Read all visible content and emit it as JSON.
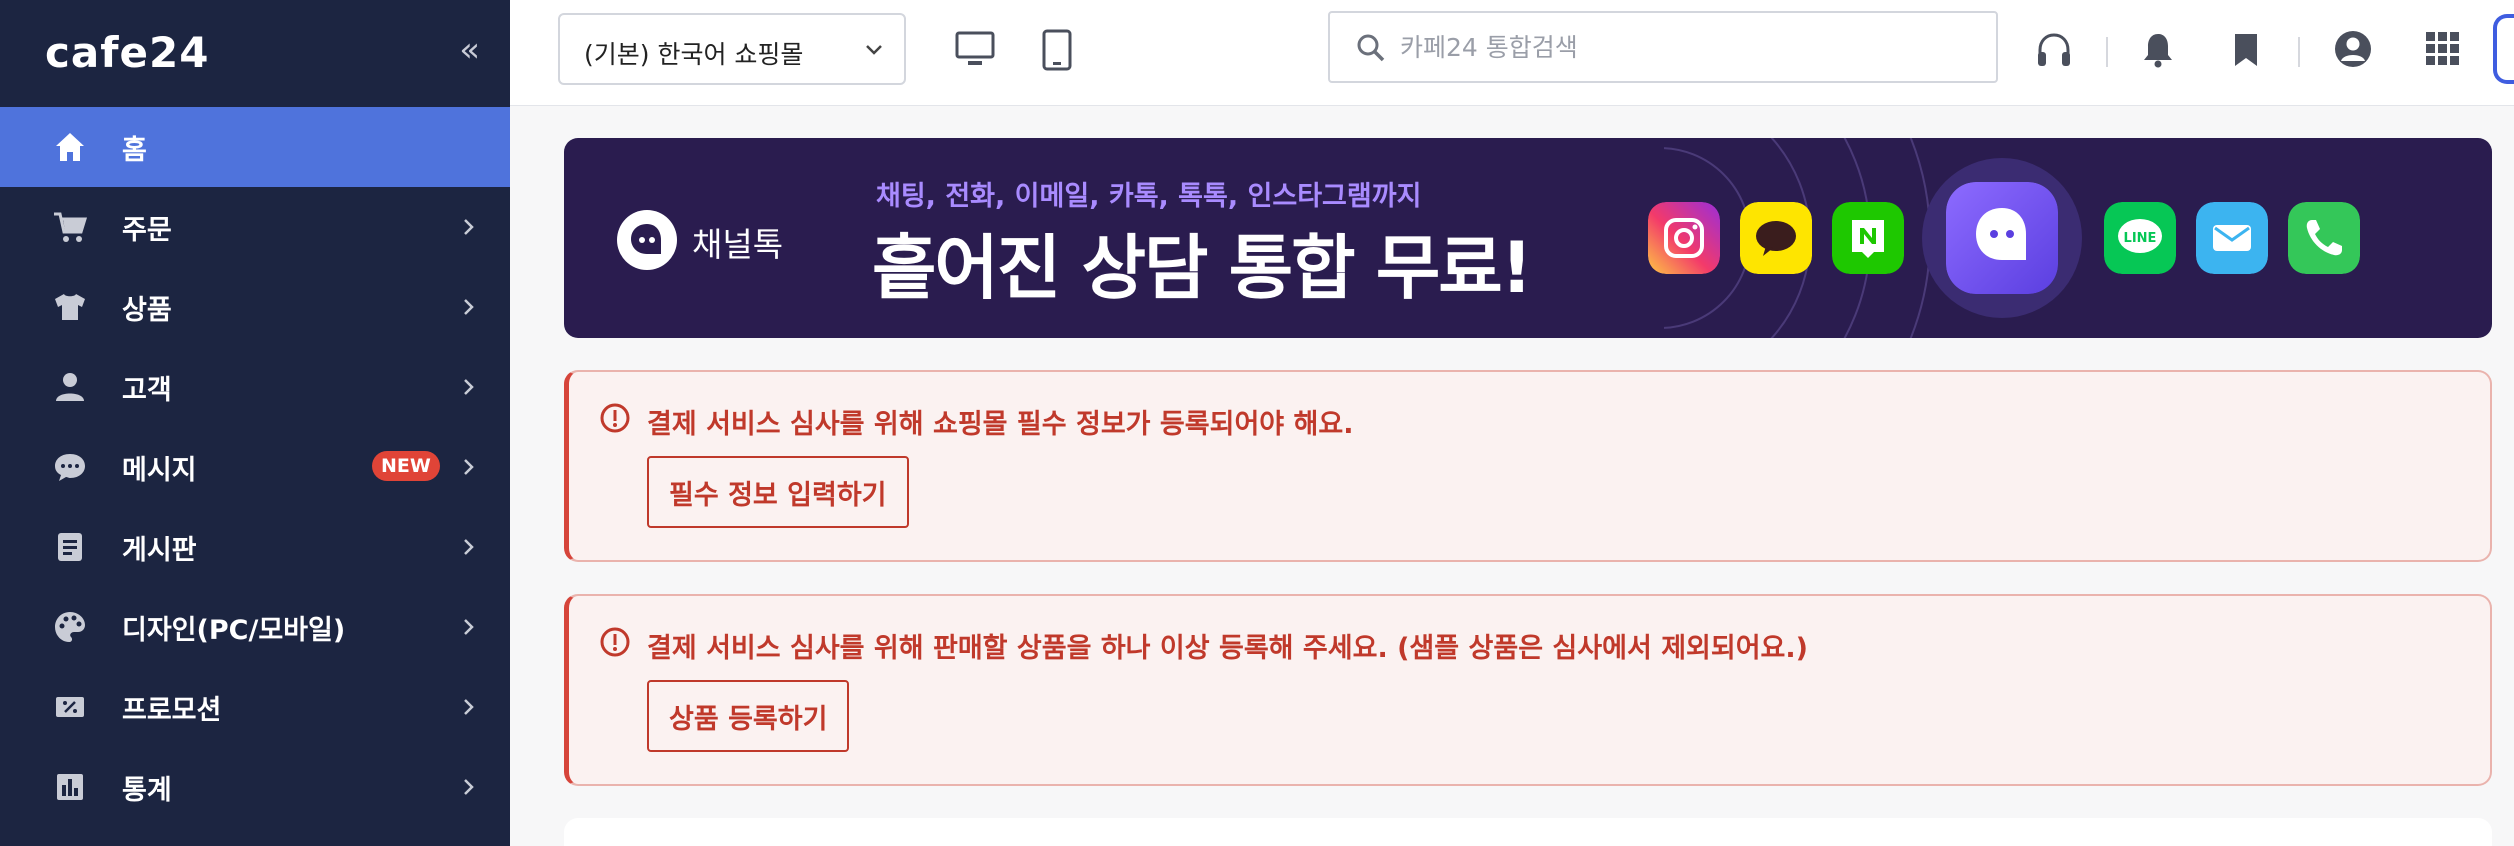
{
  "sidebar": {
    "logo": "cafe24",
    "collapse_icon": "«",
    "items": [
      {
        "label": "홈",
        "icon": "home-icon",
        "active": true
      },
      {
        "label": "주문",
        "icon": "cart-icon"
      },
      {
        "label": "상품",
        "icon": "shirt-icon"
      },
      {
        "label": "고객",
        "icon": "person-icon"
      },
      {
        "label": "메시지",
        "icon": "chat-icon",
        "badge": "NEW"
      },
      {
        "label": "게시판",
        "icon": "board-icon"
      },
      {
        "label": "디자인(PC/모바일)",
        "icon": "palette-icon"
      },
      {
        "label": "프로모션",
        "icon": "coupon-icon"
      },
      {
        "label": "통계",
        "icon": "chart-icon"
      }
    ]
  },
  "topbar": {
    "shop_select": "(기본) 한국어 쇼핑몰",
    "search_placeholder": "카페24 통합검색",
    "icons": [
      "monitor-icon",
      "tablet-icon",
      "headset-icon",
      "bell-icon",
      "bookmark-icon",
      "account-icon",
      "apps-grid-icon"
    ]
  },
  "banner": {
    "brand": "채널톡",
    "subtitle": "채팅, 전화, 이메일, 카톡, 톡톡, 인스타그램까지",
    "title": "흩어진 상담 통합 무료!",
    "apps": [
      "instagram-icon",
      "kakaotalk-icon",
      "naver-talktalk-icon",
      "channeltalk-icon",
      "line-icon",
      "email-icon",
      "phone-icon"
    ]
  },
  "alerts": [
    {
      "message": "결제 서비스 심사를 위해 쇼핑몰 필수 정보가 등록되어야 해요.",
      "button": "필수 정보 입력하기"
    },
    {
      "message": "결제 서비스 심사를 위해 판매할 상품을 하나 이상 등록해 주세요. (샘플 상품은 심사에서 제외되어요.)",
      "button": "상품 등록하기"
    }
  ],
  "colors": {
    "sidebar_bg": "#1c2541",
    "active_item": "#4f73dc",
    "banner_bg": "#2a1c4f",
    "alert_red": "#c0392b",
    "alert_bg": "#fbf2f1"
  }
}
